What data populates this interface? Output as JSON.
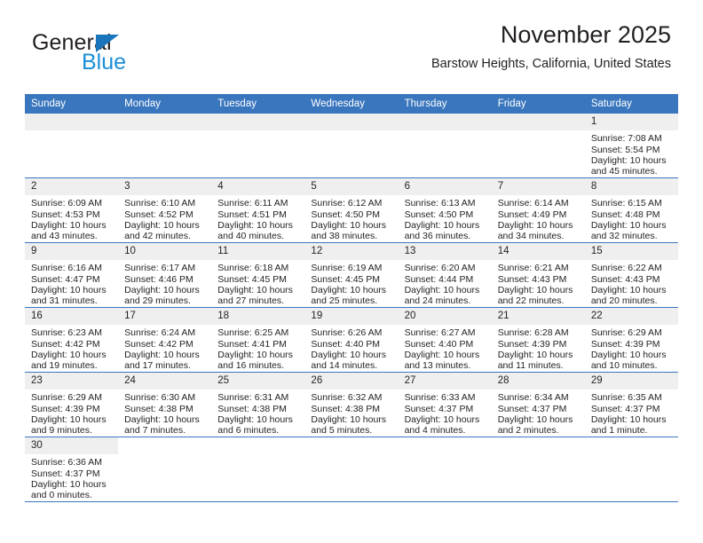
{
  "brand": {
    "word_one": "General",
    "word_two": "Blue",
    "flag_icon": "blue-flag-triangle",
    "colors": {
      "general": "#231f20",
      "blue": "#1b8ed6",
      "flag": "#1b75bb"
    }
  },
  "header": {
    "title": "November 2025",
    "subtitle": "Barstow Heights, California, United States"
  },
  "theme": {
    "header_blue": "#3a76bd",
    "daynum_band": "#efefef",
    "text": "#231f20"
  },
  "weekday_headers": [
    "Sunday",
    "Monday",
    "Tuesday",
    "Wednesday",
    "Thursday",
    "Friday",
    "Saturday"
  ],
  "labels": {
    "sunrise_prefix": "Sunrise:",
    "sunset_prefix": "Sunset:",
    "daylight_prefix": "Daylight:"
  },
  "weeks": [
    [
      {
        "day": "",
        "empty": true,
        "sunrise": "",
        "sunset": "",
        "daylight_a": "",
        "daylight_b": ""
      },
      {
        "day": "",
        "empty": true,
        "sunrise": "",
        "sunset": "",
        "daylight_a": "",
        "daylight_b": ""
      },
      {
        "day": "",
        "empty": true,
        "sunrise": "",
        "sunset": "",
        "daylight_a": "",
        "daylight_b": ""
      },
      {
        "day": "",
        "empty": true,
        "sunrise": "",
        "sunset": "",
        "daylight_a": "",
        "daylight_b": ""
      },
      {
        "day": "",
        "empty": true,
        "sunrise": "",
        "sunset": "",
        "daylight_a": "",
        "daylight_b": ""
      },
      {
        "day": "",
        "empty": true,
        "sunrise": "",
        "sunset": "",
        "daylight_a": "",
        "daylight_b": ""
      },
      {
        "day": "1",
        "empty": false,
        "sunrise": "Sunrise: 7:08 AM",
        "sunset": "Sunset: 5:54 PM",
        "daylight_a": "Daylight: 10 hours",
        "daylight_b": "and 45 minutes."
      }
    ],
    [
      {
        "day": "2",
        "empty": false,
        "sunrise": "Sunrise: 6:09 AM",
        "sunset": "Sunset: 4:53 PM",
        "daylight_a": "Daylight: 10 hours",
        "daylight_b": "and 43 minutes."
      },
      {
        "day": "3",
        "empty": false,
        "sunrise": "Sunrise: 6:10 AM",
        "sunset": "Sunset: 4:52 PM",
        "daylight_a": "Daylight: 10 hours",
        "daylight_b": "and 42 minutes."
      },
      {
        "day": "4",
        "empty": false,
        "sunrise": "Sunrise: 6:11 AM",
        "sunset": "Sunset: 4:51 PM",
        "daylight_a": "Daylight: 10 hours",
        "daylight_b": "and 40 minutes."
      },
      {
        "day": "5",
        "empty": false,
        "sunrise": "Sunrise: 6:12 AM",
        "sunset": "Sunset: 4:50 PM",
        "daylight_a": "Daylight: 10 hours",
        "daylight_b": "and 38 minutes."
      },
      {
        "day": "6",
        "empty": false,
        "sunrise": "Sunrise: 6:13 AM",
        "sunset": "Sunset: 4:50 PM",
        "daylight_a": "Daylight: 10 hours",
        "daylight_b": "and 36 minutes."
      },
      {
        "day": "7",
        "empty": false,
        "sunrise": "Sunrise: 6:14 AM",
        "sunset": "Sunset: 4:49 PM",
        "daylight_a": "Daylight: 10 hours",
        "daylight_b": "and 34 minutes."
      },
      {
        "day": "8",
        "empty": false,
        "sunrise": "Sunrise: 6:15 AM",
        "sunset": "Sunset: 4:48 PM",
        "daylight_a": "Daylight: 10 hours",
        "daylight_b": "and 32 minutes."
      }
    ],
    [
      {
        "day": "9",
        "empty": false,
        "sunrise": "Sunrise: 6:16 AM",
        "sunset": "Sunset: 4:47 PM",
        "daylight_a": "Daylight: 10 hours",
        "daylight_b": "and 31 minutes."
      },
      {
        "day": "10",
        "empty": false,
        "sunrise": "Sunrise: 6:17 AM",
        "sunset": "Sunset: 4:46 PM",
        "daylight_a": "Daylight: 10 hours",
        "daylight_b": "and 29 minutes."
      },
      {
        "day": "11",
        "empty": false,
        "sunrise": "Sunrise: 6:18 AM",
        "sunset": "Sunset: 4:45 PM",
        "daylight_a": "Daylight: 10 hours",
        "daylight_b": "and 27 minutes."
      },
      {
        "day": "12",
        "empty": false,
        "sunrise": "Sunrise: 6:19 AM",
        "sunset": "Sunset: 4:45 PM",
        "daylight_a": "Daylight: 10 hours",
        "daylight_b": "and 25 minutes."
      },
      {
        "day": "13",
        "empty": false,
        "sunrise": "Sunrise: 6:20 AM",
        "sunset": "Sunset: 4:44 PM",
        "daylight_a": "Daylight: 10 hours",
        "daylight_b": "and 24 minutes."
      },
      {
        "day": "14",
        "empty": false,
        "sunrise": "Sunrise: 6:21 AM",
        "sunset": "Sunset: 4:43 PM",
        "daylight_a": "Daylight: 10 hours",
        "daylight_b": "and 22 minutes."
      },
      {
        "day": "15",
        "empty": false,
        "sunrise": "Sunrise: 6:22 AM",
        "sunset": "Sunset: 4:43 PM",
        "daylight_a": "Daylight: 10 hours",
        "daylight_b": "and 20 minutes."
      }
    ],
    [
      {
        "day": "16",
        "empty": false,
        "sunrise": "Sunrise: 6:23 AM",
        "sunset": "Sunset: 4:42 PM",
        "daylight_a": "Daylight: 10 hours",
        "daylight_b": "and 19 minutes."
      },
      {
        "day": "17",
        "empty": false,
        "sunrise": "Sunrise: 6:24 AM",
        "sunset": "Sunset: 4:42 PM",
        "daylight_a": "Daylight: 10 hours",
        "daylight_b": "and 17 minutes."
      },
      {
        "day": "18",
        "empty": false,
        "sunrise": "Sunrise: 6:25 AM",
        "sunset": "Sunset: 4:41 PM",
        "daylight_a": "Daylight: 10 hours",
        "daylight_b": "and 16 minutes."
      },
      {
        "day": "19",
        "empty": false,
        "sunrise": "Sunrise: 6:26 AM",
        "sunset": "Sunset: 4:40 PM",
        "daylight_a": "Daylight: 10 hours",
        "daylight_b": "and 14 minutes."
      },
      {
        "day": "20",
        "empty": false,
        "sunrise": "Sunrise: 6:27 AM",
        "sunset": "Sunset: 4:40 PM",
        "daylight_a": "Daylight: 10 hours",
        "daylight_b": "and 13 minutes."
      },
      {
        "day": "21",
        "empty": false,
        "sunrise": "Sunrise: 6:28 AM",
        "sunset": "Sunset: 4:39 PM",
        "daylight_a": "Daylight: 10 hours",
        "daylight_b": "and 11 minutes."
      },
      {
        "day": "22",
        "empty": false,
        "sunrise": "Sunrise: 6:29 AM",
        "sunset": "Sunset: 4:39 PM",
        "daylight_a": "Daylight: 10 hours",
        "daylight_b": "and 10 minutes."
      }
    ],
    [
      {
        "day": "23",
        "empty": false,
        "sunrise": "Sunrise: 6:29 AM",
        "sunset": "Sunset: 4:39 PM",
        "daylight_a": "Daylight: 10 hours",
        "daylight_b": "and 9 minutes."
      },
      {
        "day": "24",
        "empty": false,
        "sunrise": "Sunrise: 6:30 AM",
        "sunset": "Sunset: 4:38 PM",
        "daylight_a": "Daylight: 10 hours",
        "daylight_b": "and 7 minutes."
      },
      {
        "day": "25",
        "empty": false,
        "sunrise": "Sunrise: 6:31 AM",
        "sunset": "Sunset: 4:38 PM",
        "daylight_a": "Daylight: 10 hours",
        "daylight_b": "and 6 minutes."
      },
      {
        "day": "26",
        "empty": false,
        "sunrise": "Sunrise: 6:32 AM",
        "sunset": "Sunset: 4:38 PM",
        "daylight_a": "Daylight: 10 hours",
        "daylight_b": "and 5 minutes."
      },
      {
        "day": "27",
        "empty": false,
        "sunrise": "Sunrise: 6:33 AM",
        "sunset": "Sunset: 4:37 PM",
        "daylight_a": "Daylight: 10 hours",
        "daylight_b": "and 4 minutes."
      },
      {
        "day": "28",
        "empty": false,
        "sunrise": "Sunrise: 6:34 AM",
        "sunset": "Sunset: 4:37 PM",
        "daylight_a": "Daylight: 10 hours",
        "daylight_b": "and 2 minutes."
      },
      {
        "day": "29",
        "empty": false,
        "sunrise": "Sunrise: 6:35 AM",
        "sunset": "Sunset: 4:37 PM",
        "daylight_a": "Daylight: 10 hours",
        "daylight_b": "and 1 minute."
      }
    ],
    [
      {
        "day": "30",
        "empty": false,
        "sunrise": "Sunrise: 6:36 AM",
        "sunset": "Sunset: 4:37 PM",
        "daylight_a": "Daylight: 10 hours",
        "daylight_b": "and 0 minutes."
      },
      {
        "day": "",
        "empty": true,
        "blank": true,
        "sunrise": "",
        "sunset": "",
        "daylight_a": "",
        "daylight_b": ""
      },
      {
        "day": "",
        "empty": true,
        "blank": true,
        "sunrise": "",
        "sunset": "",
        "daylight_a": "",
        "daylight_b": ""
      },
      {
        "day": "",
        "empty": true,
        "blank": true,
        "sunrise": "",
        "sunset": "",
        "daylight_a": "",
        "daylight_b": ""
      },
      {
        "day": "",
        "empty": true,
        "blank": true,
        "sunrise": "",
        "sunset": "",
        "daylight_a": "",
        "daylight_b": ""
      },
      {
        "day": "",
        "empty": true,
        "blank": true,
        "sunrise": "",
        "sunset": "",
        "daylight_a": "",
        "daylight_b": ""
      },
      {
        "day": "",
        "empty": true,
        "blank": true,
        "sunrise": "",
        "sunset": "",
        "daylight_a": "",
        "daylight_b": ""
      }
    ]
  ]
}
